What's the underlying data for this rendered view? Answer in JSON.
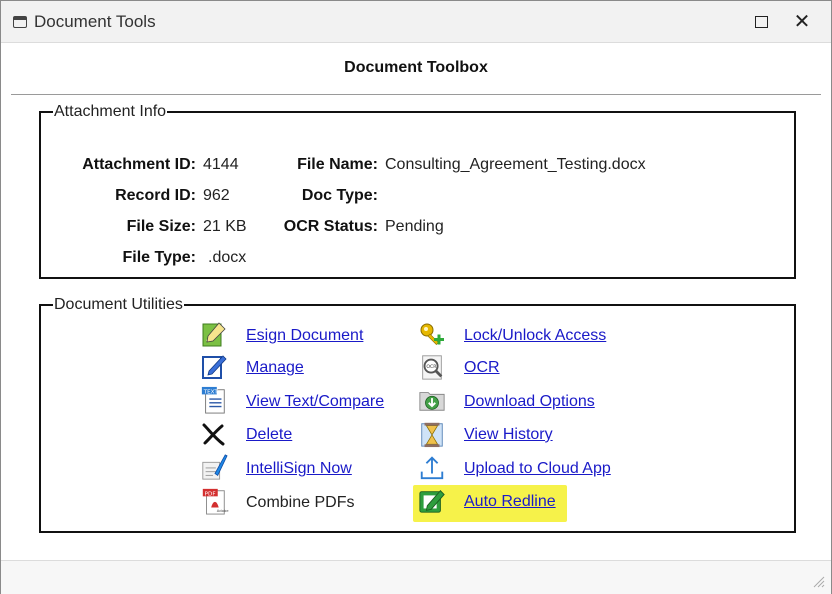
{
  "window": {
    "title": "Document Tools",
    "maximize_icon": "maximize-icon",
    "close_label": "✕"
  },
  "toolbox_title": "Document Toolbox",
  "attachment_info": {
    "legend": "Attachment Info",
    "fields": {
      "attachment_id": {
        "label": "Attachment ID:",
        "value": "4144"
      },
      "record_id": {
        "label": "Record ID:",
        "value": "962"
      },
      "file_size": {
        "label": "File Size:",
        "value": "21 KB"
      },
      "file_type": {
        "label": "File Type:",
        "value": ".docx"
      },
      "file_name": {
        "label": "File Name:",
        "value": "Consulting_Agreement_Testing.docx"
      },
      "doc_type": {
        "label": "Doc Type:",
        "value": ""
      },
      "ocr_status": {
        "label": "OCR Status:",
        "value": "Pending"
      }
    }
  },
  "document_utilities": {
    "legend": "Document Utilities",
    "left": [
      {
        "label": "Esign Document",
        "icon": "esign-icon"
      },
      {
        "label": "Manage",
        "icon": "manage-icon"
      },
      {
        "label": "View Text/Compare",
        "icon": "text-document-icon"
      },
      {
        "label": "Delete",
        "icon": "delete-x-icon"
      },
      {
        "label": "IntelliSign Now",
        "icon": "intellisign-icon"
      },
      {
        "label": "Combine PDFs",
        "icon": "pdf-icon"
      }
    ],
    "right": [
      {
        "label": "Lock/Unlock Access",
        "icon": "key-icon"
      },
      {
        "label": "OCR",
        "icon": "ocr-icon"
      },
      {
        "label": "Download Options",
        "icon": "download-icon"
      },
      {
        "label": "View History",
        "icon": "history-icon"
      },
      {
        "label": "Upload to Cloud App",
        "icon": "upload-icon"
      },
      {
        "label": "Auto Redline",
        "icon": "redline-edit-icon",
        "highlighted": true
      }
    ]
  },
  "colors": {
    "link": "#1a1ac8",
    "highlight": "#f6f24a"
  }
}
